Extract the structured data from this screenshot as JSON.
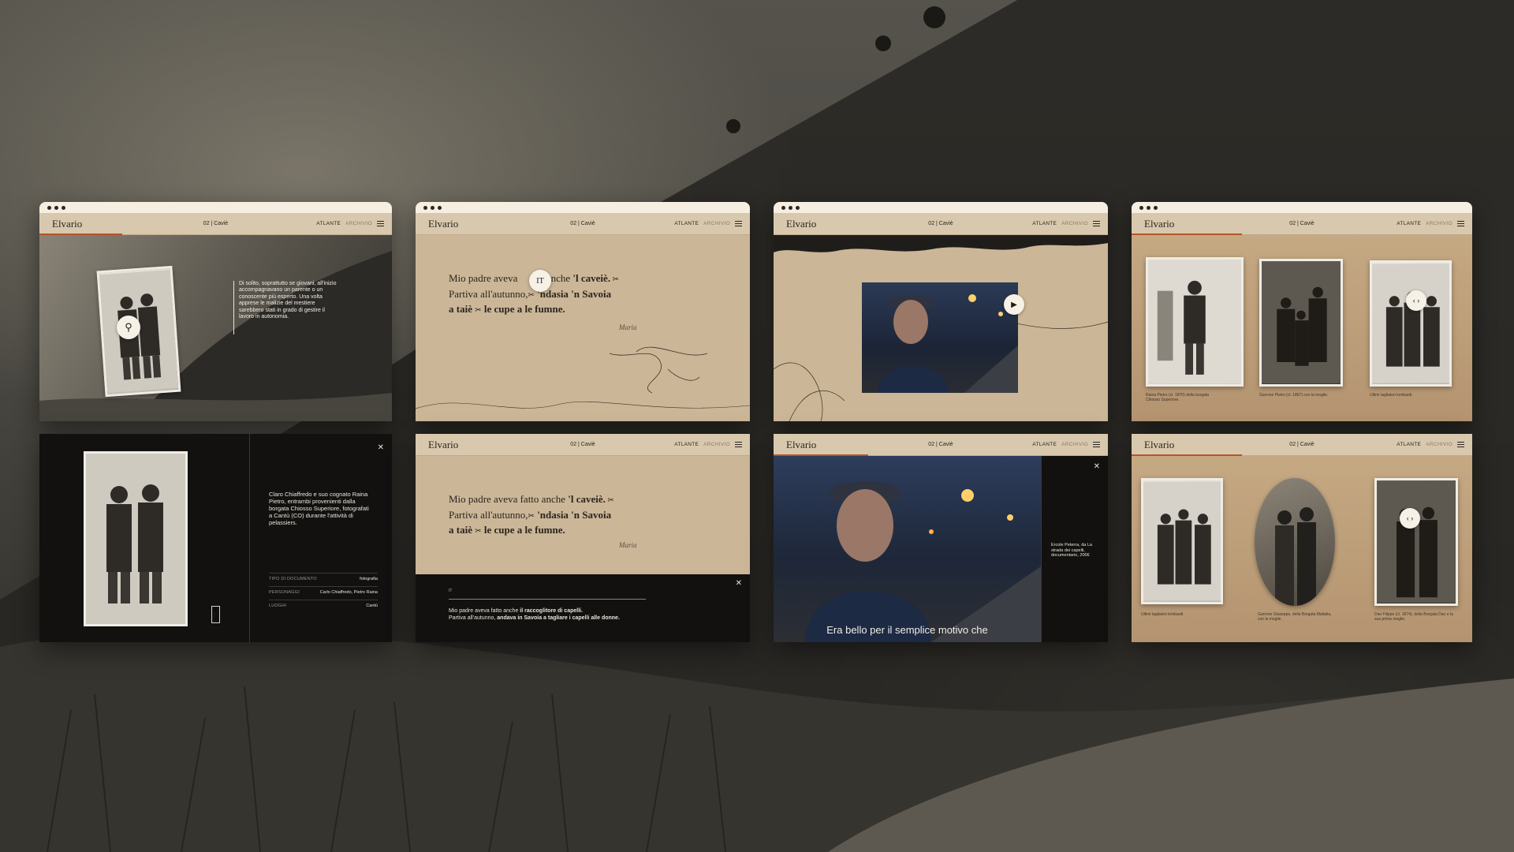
{
  "site": {
    "brand": "Elvario",
    "chapter": "02 | Caviè",
    "nav_atlas": "ATLANTE",
    "nav_archive": "ARCHIVIO"
  },
  "colors": {
    "paper": "#cbb697",
    "nav": "#d8c8ad",
    "accent": "#b5542b",
    "dark": "#121110"
  },
  "screen1": {
    "text": "Di solito, soprattutto se giovani, all'inizio accompagnavano un parente o un conoscente più esperto. Una volta apprese le malizie del mestiere sarebbero stati in grado di gestire il lavoro in autonomia.",
    "zoom_icon": "magnifier-icon"
  },
  "screen2": {
    "line1_a": "Mio padre aveva",
    "line1_b": "anche",
    "line1_c": "'l caveiè.",
    "line2_a": "Partiva all'autunno,",
    "line2_b": "'ndasia 'n Savoia",
    "line3_a": "a taiè",
    "line3_b": "le cupe a le fumne.",
    "lang_badge": "IT",
    "signature": "Maria"
  },
  "screen3": {
    "video_icon": "play-icon"
  },
  "screen4": {
    "captions": [
      "Raina Pietro (cl. 1870) della borgata Chiosso Superiore.",
      "Garrone Pietro (cl. 1867) con la moglie.",
      "Ultimi tagliatori lombardi."
    ]
  },
  "screen5": {
    "description": "Claro Chiaffredo e suo cognato Raina Pietro, entrambi provenienti dalla borgata Chiosso Superiore, fotografati a Cantù (CO) durante l'attività di pelassiers.",
    "meta": [
      {
        "k": "TIPO DI DOCUMENTO",
        "v": "fotografia"
      },
      {
        "k": "PERSONAGGI",
        "v": "Carlo Chiaffredo, Pietro Raina"
      },
      {
        "k": "LUOGHI",
        "v": "Cantù"
      }
    ],
    "zoom_in": "+",
    "zoom_out": "−"
  },
  "screen6": {
    "line1_a": "Mio padre aveva fatto anche",
    "line1_b": "'l caveiè.",
    "line2_a": "Partiva all'autunno,",
    "line2_b": "'ndasia 'n Savoia",
    "line3_a": "a taiè",
    "line3_b": "le cupe a le fumne.",
    "signature": "Maria",
    "lang_mark": "IT",
    "translation_1a": "Mio padre aveva fatto anche",
    "translation_1b": "il raccoglitore di capelli.",
    "translation_2a": "Partiva all'autunno,",
    "translation_2b": "andava in Savoia a tagliare i capelli alle donne."
  },
  "screen7": {
    "subtitle": "Era bello per il semplice motivo che",
    "credit": "Ercole Peterra, da La strada dei capelli, documentario, 2006"
  },
  "screen8": {
    "captions": [
      "Ultimi tagliatori lombardi.",
      "Garrone Giuseppe, della Borgata Maltalia, con la moglie.",
      "Dao Filippo (cl. 1874), della Borgata Dao e la sua prima moglie."
    ]
  }
}
